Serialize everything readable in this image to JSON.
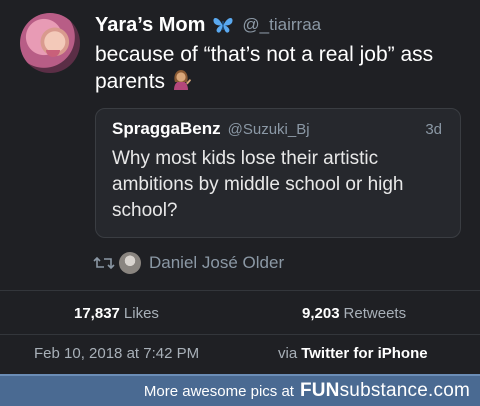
{
  "tweet": {
    "display_name": "Yara’s Mom",
    "name_emoji_icon": "butterfly-icon",
    "handle": "@_tiairraa",
    "text": "because of “that’s not a real job” ass parents",
    "text_emoji_icon": "woman-tipping-hand-icon",
    "quoted": {
      "name": "SpraggaBenz",
      "handle": "@Suzuki_Bj",
      "time": "3d",
      "text": "Why most kids lose their artistic ambitions by middle school or high school?"
    },
    "retweeted_by": "Daniel José Older",
    "stats": {
      "likes_count": "17,837",
      "likes_label": "Likes",
      "retweets_count": "9,203",
      "retweets_label": "Retweets"
    },
    "date": "Feb 10, 2018 at 7:42 PM",
    "via_label": "via",
    "via_source": "Twitter for iPhone"
  },
  "footer": {
    "text": "More awesome pics at",
    "brand_fun": "FUN",
    "brand_rest": "substance.com"
  },
  "colors": {
    "background": "#1f2024",
    "secondary_text": "#8b98a5",
    "footer_bar": "#4a6a92"
  }
}
